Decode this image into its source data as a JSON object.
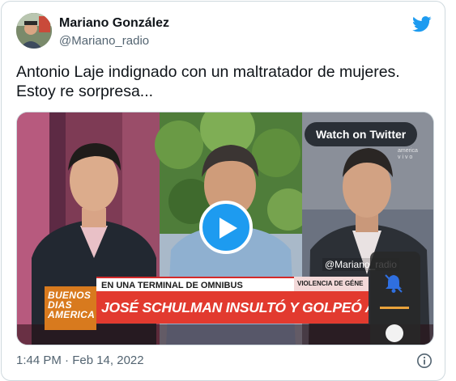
{
  "author": {
    "display_name": "Mariano González",
    "handle": "@Mariano_radio"
  },
  "tweet": {
    "text_line1": "Antonio Laje indignado con un maltratador de mujeres.",
    "text_line2": "Estoy re sorpresa..."
  },
  "media": {
    "watch_label": "Watch on Twitter",
    "program_name": [
      "BUENOS",
      "DIAS",
      "AMERICA"
    ],
    "subheadline": "EN UNA TERMINAL DE OMNIBUS",
    "topic": "VIOLENCIA DE GÉNE",
    "headline": "JOSÉ SCHULMAN INSULTÓ Y GOLPEÓ A UNA EMPLEADA",
    "watermark": "@Mariano_radio",
    "channel_bug": [
      "america",
      "v i v o"
    ]
  },
  "footer": {
    "timestamp": "1:44 PM · Feb 14, 2022"
  },
  "colors": {
    "twitter_blue": "#1d9bf0",
    "headline_red": "#e23a2f",
    "program_orange": "#d87a1e"
  },
  "icons": [
    "twitter-bird-icon",
    "play-icon",
    "bell-icon",
    "info-icon"
  ]
}
